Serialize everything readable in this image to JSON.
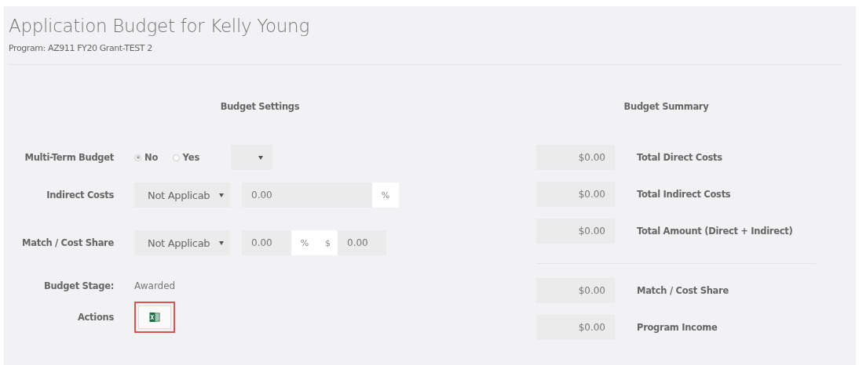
{
  "page": {
    "title": "Application Budget for Kelly Young",
    "subtitle": "Program: AZ911 FY20 Grant-TEST 2"
  },
  "settings": {
    "heading": "Budget Settings",
    "rows": [
      {
        "kind": "radio",
        "label": "Multi-Term Budget",
        "options": [
          {
            "label": "No",
            "selected": true
          },
          {
            "label": "Yes",
            "selected": false
          }
        ]
      },
      {
        "kind": "percent",
        "label": "Indirect Costs",
        "select": "Not Applicab",
        "value": "0.00",
        "unit": "%"
      },
      {
        "kind": "match",
        "label": "Match / Cost Share",
        "select": "Not Applicab",
        "percent": "0.00",
        "percent_unit": "%",
        "dollar_unit": "$",
        "amount": "0.00"
      },
      {
        "kind": "text",
        "label": "Budget Stage:",
        "value": "Awarded"
      },
      {
        "kind": "actions",
        "label": "Actions",
        "highlighted": true
      }
    ]
  },
  "summary": {
    "heading": "Budget Summary",
    "groups": [
      [
        {
          "value": "$0.00",
          "label": "Total Direct Costs"
        },
        {
          "value": "$0.00",
          "label": "Total Indirect Costs"
        },
        {
          "value": "$0.00",
          "label": "Total Amount (Direct + Indirect)"
        }
      ],
      [
        {
          "value": "$0.00",
          "label": "Match / Cost Share"
        },
        {
          "value": "$0.00",
          "label": "Program Income"
        }
      ]
    ]
  }
}
